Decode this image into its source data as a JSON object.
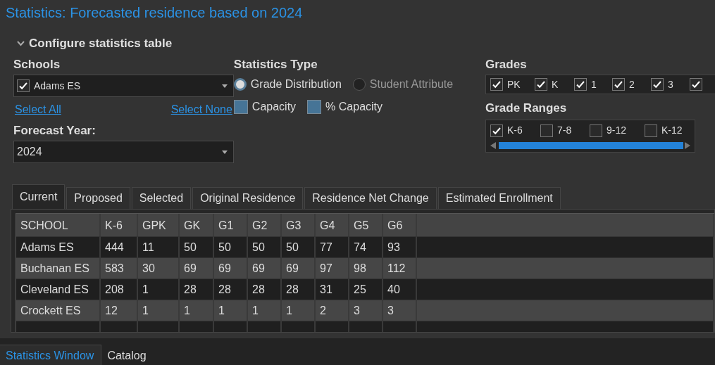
{
  "title": "Statistics: Forecasted residence based on 2024",
  "config": {
    "label": "Configure statistics table",
    "expanded": true
  },
  "schools": {
    "label": "Schools",
    "selected_school": {
      "label": "Adams ES",
      "checked": true
    },
    "select_all": "Select All",
    "select_none": "Select None"
  },
  "forecast_year": {
    "label": "Forecast Year:",
    "value": "2024"
  },
  "statistics_type": {
    "label": "Statistics Type",
    "options": [
      {
        "label": "Grade Distribution",
        "selected": true
      },
      {
        "label": "Student Attribute",
        "selected": false
      }
    ],
    "checkboxes": [
      {
        "label": "Capacity",
        "checked": false
      },
      {
        "label": "% Capacity",
        "checked": false
      }
    ]
  },
  "grades": {
    "label": "Grades",
    "items": [
      {
        "label": "PK",
        "checked": true
      },
      {
        "label": "K",
        "checked": true
      },
      {
        "label": "1",
        "checked": true
      },
      {
        "label": "2",
        "checked": true
      },
      {
        "label": "3",
        "checked": true
      },
      {
        "checked": true
      }
    ]
  },
  "grade_ranges": {
    "label": "Grade Ranges",
    "items": [
      {
        "label": "K-6",
        "checked": true
      },
      {
        "label": "7-8",
        "checked": false
      },
      {
        "label": "9-12",
        "checked": false
      },
      {
        "label": "K-12",
        "checked": false
      }
    ]
  },
  "tabs": [
    {
      "label": "Current",
      "selected": true
    },
    {
      "label": "Proposed",
      "selected": false
    },
    {
      "label": "Selected",
      "selected": false
    },
    {
      "label": "Original Residence",
      "selected": false
    },
    {
      "label": "Residence Net Change",
      "selected": false
    },
    {
      "label": "Estimated Enrollment",
      "selected": false
    }
  ],
  "table": {
    "columns": [
      "SCHOOL",
      "K-6",
      "GPK",
      "GK",
      "G1",
      "G2",
      "G3",
      "G4",
      "G5",
      "G6"
    ],
    "rows": [
      [
        "Adams ES",
        "444",
        "11",
        "50",
        "50",
        "50",
        "50",
        "77",
        "74",
        "93"
      ],
      [
        "Buchanan ES",
        "583",
        "30",
        "69",
        "69",
        "69",
        "69",
        "97",
        "98",
        "112"
      ],
      [
        "Cleveland ES",
        "208",
        "1",
        "28",
        "28",
        "28",
        "28",
        "31",
        "25",
        "40"
      ],
      [
        "Crockett ES",
        "12",
        "1",
        "1",
        "1",
        "1",
        "1",
        "2",
        "3",
        "3"
      ]
    ]
  },
  "bottom_tabs": [
    {
      "label": "Statistics Window",
      "selected": true
    },
    {
      "label": "Catalog",
      "selected": false
    }
  ]
}
